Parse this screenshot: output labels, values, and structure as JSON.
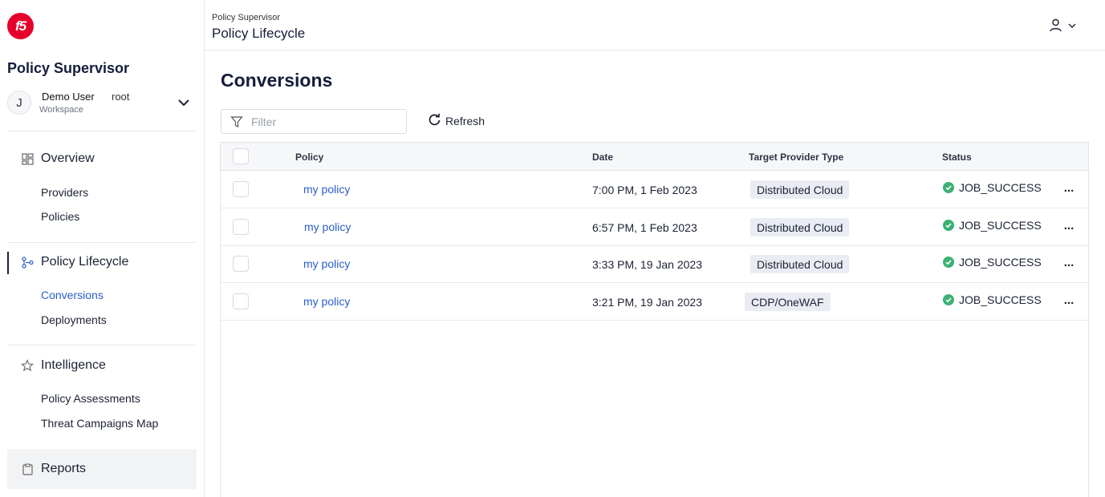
{
  "brand": {
    "logo_text": "f5",
    "logo_color": "#e4002b"
  },
  "sidebar": {
    "app_title": "Policy Supervisor",
    "workspace": {
      "avatar_initial": "J",
      "user": "Demo User",
      "role": "root",
      "label": "Workspace"
    },
    "groups": [
      {
        "label": "Overview",
        "icon": "dashboard-icon",
        "items": [
          "Providers",
          "Policies"
        ]
      },
      {
        "label": "Policy Lifecycle",
        "icon": "lifecycle-icon",
        "items": [
          "Conversions",
          "Deployments"
        ],
        "active_item": "Conversions"
      },
      {
        "label": "Intelligence",
        "icon": "star-icon",
        "items": [
          "Policy Assessments",
          "Threat Campaigns Map"
        ]
      },
      {
        "label": "Reports",
        "icon": "clipboard-icon",
        "items": []
      }
    ]
  },
  "header": {
    "breadcrumb": "Policy Supervisor",
    "title": "Policy Lifecycle",
    "user_icon": "user-icon"
  },
  "main": {
    "title": "Conversions",
    "filter_placeholder": "Filter",
    "refresh_label": "Refresh",
    "table": {
      "columns": [
        "Policy",
        "Date",
        "Target Provider Type",
        "Status"
      ],
      "rows": [
        {
          "policy": "my policy",
          "date": "7:00 PM, 1 Feb 2023",
          "target": "Distributed Cloud",
          "status": "JOB_SUCCESS"
        },
        {
          "policy": "my policy",
          "date": "6:57 PM, 1 Feb 2023",
          "target": "Distributed Cloud",
          "status": "JOB_SUCCESS"
        },
        {
          "policy": "my policy",
          "date": "3:33 PM, 19 Jan 2023",
          "target": "Distributed Cloud",
          "status": "JOB_SUCCESS"
        },
        {
          "policy": "my policy",
          "date": "3:21 PM, 19 Jan 2023",
          "target": "CDP/OneWAF",
          "status": "JOB_SUCCESS"
        }
      ],
      "row_menu": "...",
      "status_color": "#3bb273"
    }
  },
  "colors": {
    "accent": "#2a5dcc",
    "text": "#151d3b"
  }
}
